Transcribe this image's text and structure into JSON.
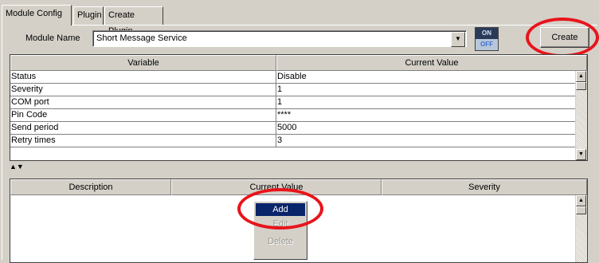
{
  "tabs": [
    "Module Config",
    "Plugin",
    "Create Plugin"
  ],
  "module": {
    "label": "Module Name",
    "value": "Short Message Service",
    "toggle_on": "ON",
    "toggle_off": "OFF",
    "create_label": "Create"
  },
  "variables_table": {
    "headers": [
      "Variable",
      "Current Value"
    ],
    "rows": [
      [
        "Status",
        "Disable"
      ],
      [
        "Severity",
        "1"
      ],
      [
        "COM port",
        "1"
      ],
      [
        "Pin Code",
        "****"
      ],
      [
        "Send period",
        "5000"
      ],
      [
        "Retry times",
        "3"
      ]
    ]
  },
  "events_table": {
    "headers": [
      "Description",
      "Current Value",
      "Severity"
    ]
  },
  "context_menu": {
    "items": [
      "Add",
      "Edit",
      "Delete"
    ]
  },
  "colors": {
    "highlight": "#e8141b",
    "menu_selection": "#0a246a",
    "window_face": "#d4d0c8"
  }
}
